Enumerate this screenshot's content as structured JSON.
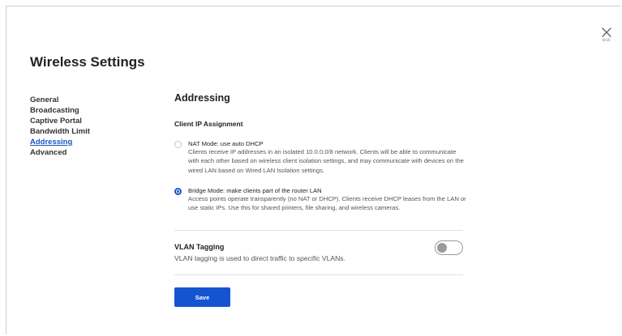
{
  "page": {
    "title": "Wireless Settings"
  },
  "close": {
    "hint": "esc",
    "icon": "close-icon"
  },
  "sidebar": {
    "items": [
      {
        "label": "General",
        "active": false
      },
      {
        "label": "Broadcasting",
        "active": false
      },
      {
        "label": "Captive Portal",
        "active": false
      },
      {
        "label": "Bandwidth Limit",
        "active": false
      },
      {
        "label": "Addressing",
        "active": true
      },
      {
        "label": "Advanced",
        "active": false
      }
    ]
  },
  "addressing": {
    "title": "Addressing",
    "client_ip": {
      "heading": "Client IP Assignment",
      "options": [
        {
          "label": "NAT Mode: use auto DHCP",
          "description": "Clients receive IP addresses in an isolated 10.0.0.0/8 network. Clients will be able to communicate with each other based on wireless client isolation settings, and may communicate with devices on the wired LAN based on Wired LAN Isolation settings.",
          "selected": false
        },
        {
          "label": "Bridge Mode: make clients part of the router LAN",
          "description": "Access points operate transparently (no NAT or DHCP). Clients receive DHCP leases from the LAN or use static IPs. Use this for shared printers, file sharing, and wireless cameras.",
          "selected": true
        }
      ]
    },
    "vlan": {
      "title": "VLAN Tagging",
      "description": "VLAN tagging is used to direct traffic to specific VLANs.",
      "enabled": false
    },
    "save_label": "Save"
  },
  "colors": {
    "accent": "#1a55c9",
    "button": "#1554d1",
    "toggle_off": "#9a9a9a",
    "divider": "#e2e2e2"
  }
}
